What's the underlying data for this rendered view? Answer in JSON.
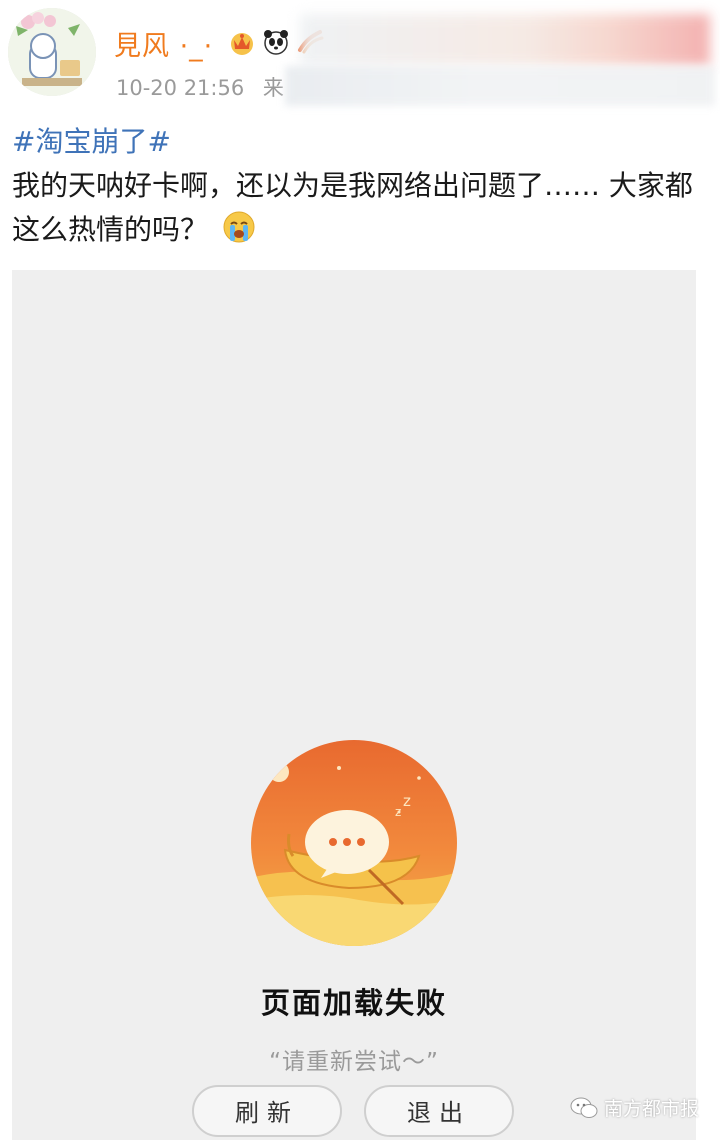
{
  "post": {
    "username": "見风 ·_·",
    "time": "10-20 21:56",
    "source_prefix": "来",
    "hashtag": "#淘宝崩了#",
    "text": "我的天呐好卡啊，还以为是我网络出问题了…… 大家都这么热情的吗？",
    "badges": [
      "crown-icon",
      "panda-icon",
      "ribbon-icon"
    ]
  },
  "screenshot": {
    "error_title": "页面加载失败",
    "error_hint": "“请重新尝试～”",
    "buttons": {
      "refresh": "刷新",
      "exit": "退出"
    }
  },
  "watermark": {
    "label": "南方都市报"
  },
  "colors": {
    "username": "#f07b1e",
    "hashtag": "#3f73b8",
    "illustration_top": "#e8763a",
    "illustration_bottom": "#f4c64f"
  }
}
